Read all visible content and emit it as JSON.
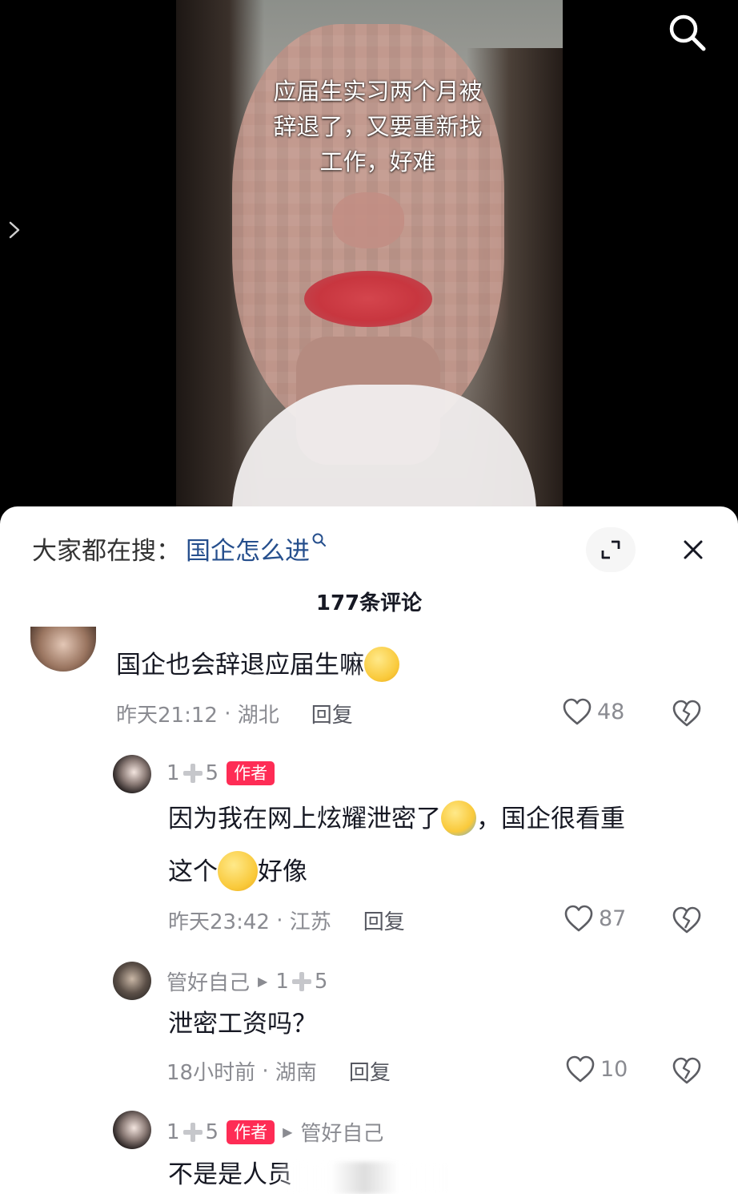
{
  "video": {
    "caption": "应届生实习两个月被\n辞退了，又要重新找\n工作，好难"
  },
  "sheet": {
    "suggest_prefix": "大家都在搜：",
    "suggest_term": "国企怎么进",
    "comment_count": "177条评论"
  },
  "comments": [
    {
      "text": "国企也会辞退应届生嘛",
      "time": "昨天21:12",
      "location": "湖北",
      "reply_label": "回复",
      "likes": "48"
    },
    {
      "name_a": "1",
      "name_b": "5",
      "badge": "作者",
      "text_line1_a": "因为我在网上炫耀泄密了",
      "text_line1_b": "，国企很看重",
      "text_line2_a": "这个",
      "text_line2_b": "好像",
      "time": "昨天23:42",
      "location": "江苏",
      "reply_label": "回复",
      "likes": "87"
    },
    {
      "name": "管好自己",
      "reply_to_a": "1",
      "reply_to_b": "5",
      "text": "泄密工资吗？",
      "time": "18小时前",
      "location": "湖南",
      "reply_label": "回复",
      "likes": "10"
    },
    {
      "name_a": "1",
      "name_b": "5",
      "badge": "作者",
      "reply_to": "管好自己",
      "text": "不是是人员"
    }
  ],
  "icons": {
    "search": "search-icon",
    "chevron": "chevron-right-icon",
    "expand": "expand-icon",
    "close": "close-icon",
    "like": "heart-outline-icon",
    "dislike": "broken-heart-icon"
  },
  "colors": {
    "accent_link": "#264f8d",
    "badge": "#fe2c55",
    "muted": "#8a8b91"
  }
}
